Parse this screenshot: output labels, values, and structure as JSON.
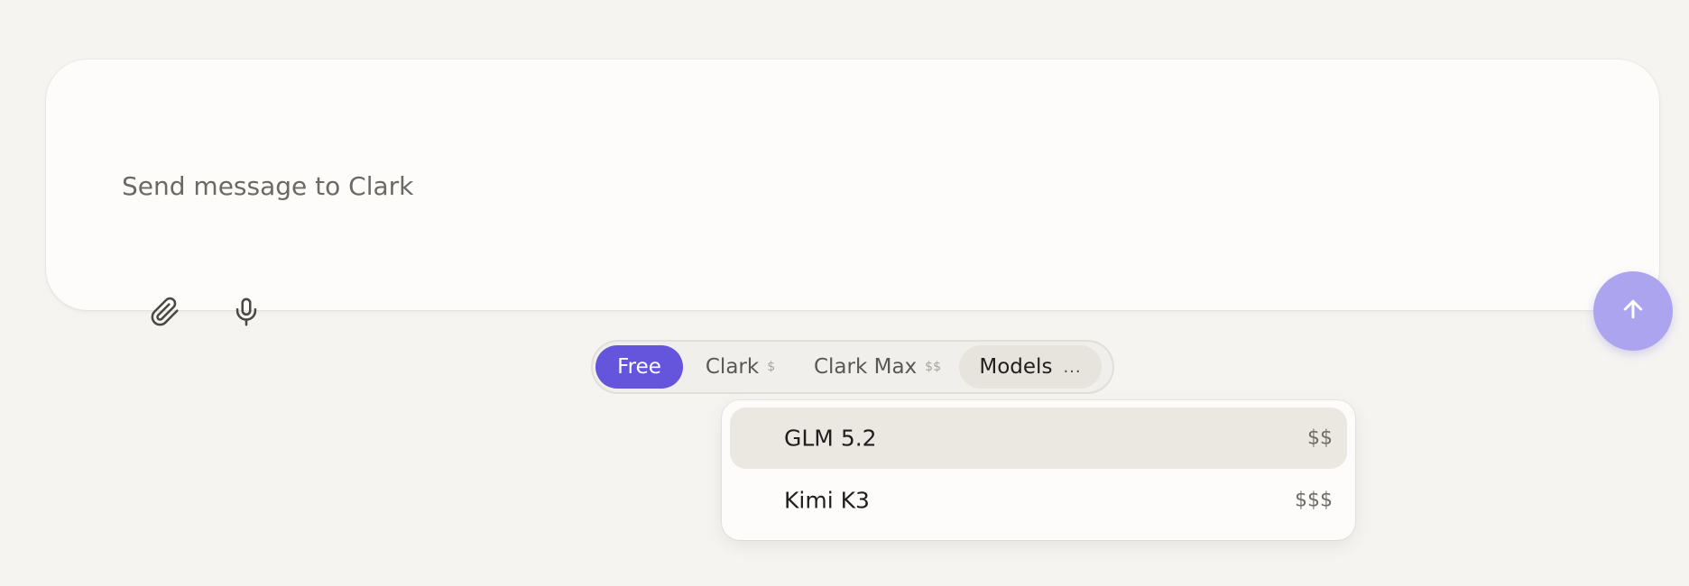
{
  "composer": {
    "placeholder": "Send message to Clark",
    "attach_icon": "paperclip-icon",
    "mic_icon": "microphone-icon",
    "send_icon": "arrow-up-icon",
    "send_button_color": "#ada4ef"
  },
  "modes": {
    "active": "Free",
    "accent_color": "#6554dc",
    "items": [
      {
        "label": "Free",
        "price": ""
      },
      {
        "label": "Clark",
        "price": "$"
      },
      {
        "label": "Clark Max",
        "price": "$$"
      },
      {
        "label": "Models",
        "more": "..."
      }
    ]
  },
  "model_menu": {
    "highlighted": "GLM 5.2",
    "items": [
      {
        "name": "GLM 5.2",
        "cost": "$$"
      },
      {
        "name": "Kimi K3",
        "cost": "$$$"
      }
    ]
  }
}
